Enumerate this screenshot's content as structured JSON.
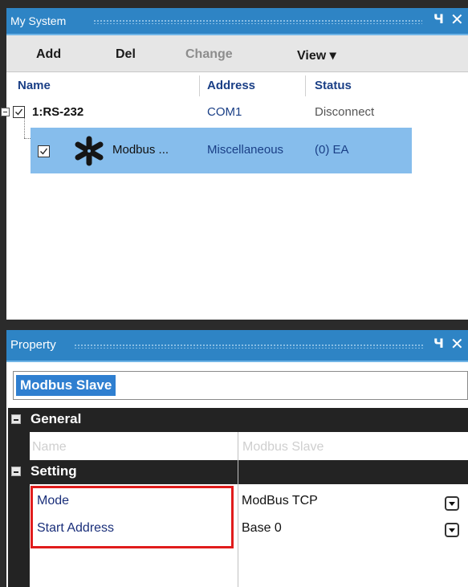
{
  "system_panel": {
    "title": "My System",
    "pin_glyph": "Ч",
    "close_glyph": "✕",
    "toolbar": {
      "add": "Add",
      "del": "Del",
      "change": "Change",
      "view": "View ▾"
    },
    "columns": {
      "name": "Name",
      "address": "Address",
      "status": "Status"
    },
    "tree": [
      {
        "name": "1:RS-232",
        "address": "COM1",
        "status": "Disconnect",
        "checked": true,
        "expanded": true
      },
      {
        "name": "Modbus ...",
        "address": "Miscellaneous",
        "status": "(0) EA",
        "checked": true,
        "selected": true,
        "icon": "modbus-device-icon"
      }
    ]
  },
  "property_panel": {
    "title": "Property",
    "object_name": "Modbus Slave",
    "categories": {
      "general": {
        "label": "General",
        "rows": [
          {
            "name": "Name",
            "value": "Modbus Slave",
            "disabled": true
          }
        ]
      },
      "setting": {
        "label": "Setting",
        "rows": [
          {
            "name": "Mode",
            "value": "ModBus TCP",
            "has_dropdown": true
          },
          {
            "name": "Start Address",
            "value": "Base 0",
            "has_dropdown": true
          }
        ]
      }
    }
  },
  "colors": {
    "title_blue": "#2e84c5",
    "selection_blue": "#86bdec",
    "header_text": "#1a3f86",
    "category_bg": "#232323",
    "highlight_red": "#e01c1c"
  }
}
